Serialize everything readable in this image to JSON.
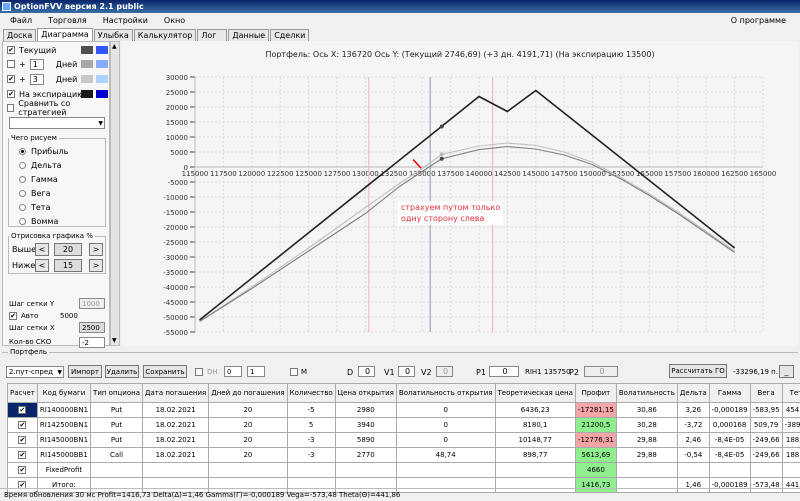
{
  "window": {
    "title": "OptionFVV версия 2.1 public"
  },
  "menu": {
    "items": [
      "Файл",
      "Торговля",
      "Настройки",
      "Окно"
    ],
    "about": "О программе"
  },
  "tabs": [
    "Доска",
    "Диаграмма",
    "Улыбка",
    "Калькулятор",
    "Лог",
    "Данные",
    "Сделки"
  ],
  "left": {
    "current": {
      "label": "Текущий",
      "checked": true,
      "colors": [
        "#505050",
        "#3355ff"
      ]
    },
    "plus1": {
      "sign": "+",
      "value": "1",
      "unit": "Дней",
      "checked": false,
      "colors": [
        "#a8a8a8",
        "#88aaff"
      ]
    },
    "plus3": {
      "sign": "+",
      "value": "3",
      "unit": "Дней",
      "checked": true,
      "colors": [
        "#c8c8c8",
        "#aad4ff"
      ]
    },
    "expiry": {
      "label": "На экспирацию",
      "checked": true,
      "colors": [
        "#1a1a1a",
        "#0000cc"
      ]
    },
    "compare": {
      "label": "Сравнить со стратегией",
      "checked": false
    },
    "what_group": "Чего рисуем",
    "radios": [
      "Прибыль",
      "Дельта",
      "Гамма",
      "Вега",
      "Тета",
      "Вомма"
    ],
    "render_group": "Отрисовка графика %",
    "above_label": "Выше",
    "above_value": "20",
    "below_label": "Ниже",
    "below_value": "15",
    "prev": "<",
    "next": ">",
    "grid_y_label": "Шаг сетки Y",
    "grid_y_value": "1000",
    "auto_label": "Авто",
    "auto_value": "5000",
    "grid_x_label": "Шаг сетки X",
    "grid_x_value": "2500",
    "sko_label": "Кол-во СКО",
    "sko_value": "-2"
  },
  "chart_header": "Портфель: Ось X: 136720 Ось Y:  (Текущий 2746,69)  (+3 дн. 4191,71)  (На экспирацию 13500)",
  "annotation": [
    "страхуем путом только",
    "одну сторону слева"
  ],
  "chart_data": {
    "type": "line",
    "xlim": [
      115000,
      165000
    ],
    "ylim": [
      -55000,
      30000
    ],
    "x_ticks": [
      115000,
      117500,
      120000,
      122500,
      125000,
      127500,
      130000,
      132500,
      135000,
      137500,
      140000,
      142500,
      145000,
      147500,
      150000,
      152500,
      155000,
      157500,
      160000,
      162500,
      165000
    ],
    "y_ticks": [
      30000,
      25000,
      20000,
      15000,
      10000,
      5000,
      0,
      -5000,
      -10000,
      -15000,
      -20000,
      -25000,
      -30000,
      -35000,
      -40000,
      -45000,
      -50000,
      -55000
    ],
    "grid": true,
    "cursor_x": 135700,
    "red_lines_x": [
      130300,
      141200
    ],
    "series": [
      {
        "key": "expiry",
        "color": "#222222",
        "points": [
          [
            115400,
            -51000
          ],
          [
            140000,
            23500
          ],
          [
            142500,
            18500
          ],
          [
            145000,
            25500
          ],
          [
            162500,
            -27000
          ]
        ],
        "marker": [
          136720,
          13500
        ]
      },
      {
        "key": "plus3",
        "color": "#c0c0c0",
        "points": [
          [
            115400,
            -51500
          ],
          [
            120000,
            -40000
          ],
          [
            125000,
            -27000
          ],
          [
            130000,
            -13500
          ],
          [
            133000,
            -5500
          ],
          [
            135000,
            -500
          ],
          [
            136720,
            4191.71
          ],
          [
            140000,
            7000
          ],
          [
            142500,
            8000
          ],
          [
            145000,
            7200
          ],
          [
            147500,
            5000
          ],
          [
            150000,
            1500
          ],
          [
            152500,
            -3500
          ],
          [
            155000,
            -9000
          ],
          [
            157500,
            -15000
          ],
          [
            160000,
            -21500
          ],
          [
            162500,
            -28000
          ]
        ],
        "marker": [
          136720,
          4191.71
        ]
      },
      {
        "key": "current",
        "color": "#808080",
        "points": [
          [
            115400,
            -51500
          ],
          [
            120000,
            -40500
          ],
          [
            125000,
            -28000
          ],
          [
            130000,
            -15500
          ],
          [
            133000,
            -6500
          ],
          [
            135000,
            -1500
          ],
          [
            136720,
            2746.69
          ],
          [
            140000,
            5800
          ],
          [
            142500,
            6800
          ],
          [
            145000,
            6000
          ],
          [
            147500,
            4000
          ],
          [
            150000,
            800
          ],
          [
            152500,
            -4000
          ],
          [
            155000,
            -9500
          ],
          [
            157500,
            -15500
          ],
          [
            160000,
            -22000
          ],
          [
            162500,
            -28500
          ]
        ],
        "marker": [
          136720,
          2746.69
        ]
      }
    ]
  },
  "portfolio": {
    "label": "Портфель",
    "strategy": "2.пут-спред",
    "import": "Импорт",
    "delete": "Удалить",
    "save": "Сохранить",
    "dh": "DH",
    "spin1": "0",
    "spin2": "1",
    "m": "M",
    "d_label": "D",
    "d": "0",
    "v1_label": "V1",
    "v1": "0",
    "v2_label": "V2",
    "v2": "0",
    "p1_label": "P1",
    "p1": "0",
    "rih": "RIH1 135750",
    "p2_label": "P2",
    "p2": "0",
    "calc_go": "Рассчитать ГО",
    "go_value": "-33296,19 п.",
    "minimize": "_",
    "columns": [
      "Расчет",
      "Код бумаги",
      "Тип опциона",
      "Дата погашения",
      "Дней до погашения",
      "Количество",
      "Цена открытия",
      "Волатильность открытия",
      "Теоретическая цена",
      "Профит",
      "Волатильность",
      "Дельта",
      "Гамма",
      "Вега",
      "Тета",
      "X"
    ],
    "rows": [
      [
        "RI140000BN1",
        "Put",
        "18.02.2021",
        "20",
        "-5",
        "2980",
        "0",
        "6436,23",
        "-17281,15",
        "30,86",
        "3,26",
        "-0,000189",
        "-583,95",
        "454,89"
      ],
      [
        "RI142500BN1",
        "Put",
        "18.02.2021",
        "20",
        "5",
        "3940",
        "0",
        "8180,1",
        "21200,5",
        "30,28",
        "-3,72",
        "0,000168",
        "509,79",
        "-389,65"
      ],
      [
        "RI145000BN1",
        "Put",
        "18.02.2021",
        "20",
        "-3",
        "5890",
        "0",
        "10148,77",
        "-12776,31",
        "29,88",
        "2,46",
        "-8,4E-05",
        "-249,66",
        "188,31"
      ],
      [
        "RI145000BB1",
        "Call",
        "18.02.2021",
        "20",
        "-3",
        "2770",
        "48,74",
        "898,77",
        "5613,69",
        "29,88",
        "-0,54",
        "-8,4E-05",
        "-249,66",
        "188,31"
      ],
      [
        "FixedProfit",
        "",
        "",
        "",
        "",
        "",
        "",
        "",
        "4660",
        "",
        "",
        "",
        "",
        ""
      ],
      [
        "Итого:",
        "",
        "",
        "",
        "",
        "",
        "",
        "",
        "1416,73",
        "",
        "1,46",
        "-0,000189",
        "-573,48",
        "441,86"
      ]
    ],
    "delete_glyph": "X",
    "check_glyph": "✔"
  },
  "status": "Время обновления 30 мс  Profit=1416,73 Delta(Δ)=1,46 Gamma(Γ)=-0,000189 Vega=-573,48 Theta(Θ)=441,86"
}
